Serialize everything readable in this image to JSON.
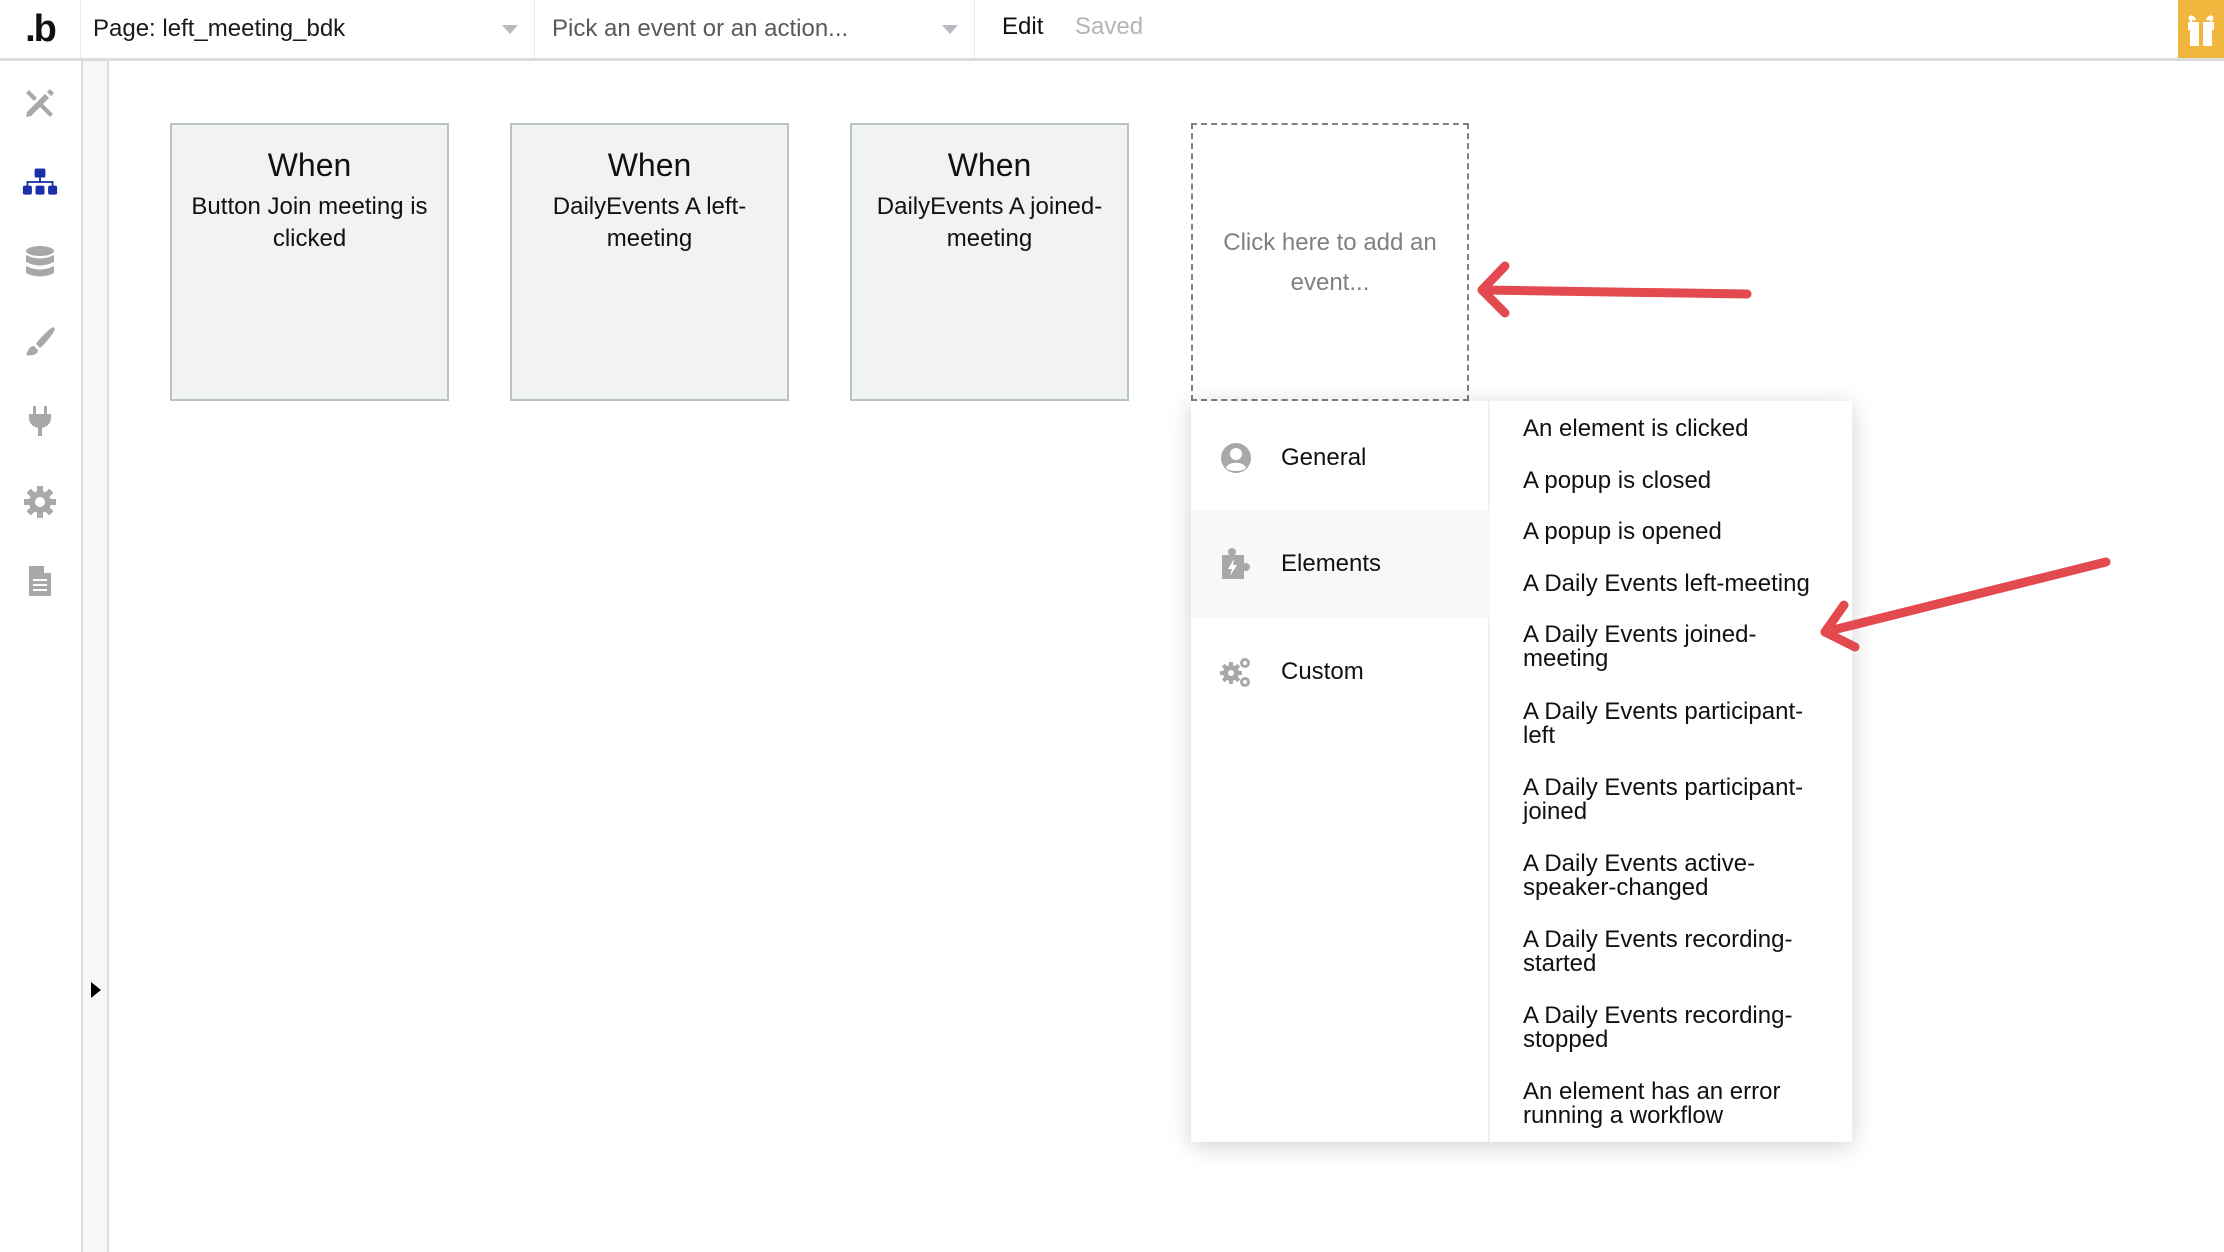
{
  "header": {
    "logo": ".b",
    "page_select": "Page: left_meeting_bdk",
    "event_select_placeholder": "Pick an event or an action...",
    "edit_label": "Edit",
    "saved_label": "Saved",
    "gift_icon": "gift-icon",
    "accent_color": "#f0b63e"
  },
  "sidebar": {
    "items": [
      {
        "name": "design",
        "icon": "design-tools-icon",
        "active": false
      },
      {
        "name": "workflow",
        "icon": "workflow-icon",
        "active": true
      },
      {
        "name": "data",
        "icon": "database-icon",
        "active": false
      },
      {
        "name": "styles",
        "icon": "paintbrush-icon",
        "active": false
      },
      {
        "name": "plugins",
        "icon": "plug-icon",
        "active": false
      },
      {
        "name": "settings",
        "icon": "gear-icon",
        "active": false
      },
      {
        "name": "logs",
        "icon": "document-icon",
        "active": false
      }
    ],
    "active_color": "#1a2fa8",
    "inactive_color": "#a8a8a8"
  },
  "workflows": [
    {
      "when": "When",
      "description": "Button Join meeting is clicked"
    },
    {
      "when": "When",
      "description": "DailyEvents A left-meeting"
    },
    {
      "when": "When",
      "description": "DailyEvents A joined-meeting"
    }
  ],
  "add_event": {
    "placeholder": "Click here to add an event..."
  },
  "event_dropdown": {
    "categories": [
      {
        "label": "General",
        "icon": "user-circle-icon",
        "active": false
      },
      {
        "label": "Elements",
        "icon": "puzzle-bolt-icon",
        "active": true
      },
      {
        "label": "Custom",
        "icon": "gears-icon",
        "active": false
      }
    ],
    "items": [
      "An element is clicked",
      "A popup is closed",
      "A popup is opened",
      "A Daily Events left-meeting",
      "A Daily Events joined-meeting",
      "A Daily Events participant-left",
      "A Daily Events participant-joined",
      "A Daily Events active-speaker-changed",
      "A Daily Events recording-started",
      "A Daily Events recording-stopped",
      "An element has an error running a workflow"
    ]
  },
  "annotations": {
    "arrow_color": "#e34a50",
    "arrows": [
      "arrow-pointing-to-add-event",
      "arrow-pointing-to-joined-meeting-item"
    ]
  }
}
